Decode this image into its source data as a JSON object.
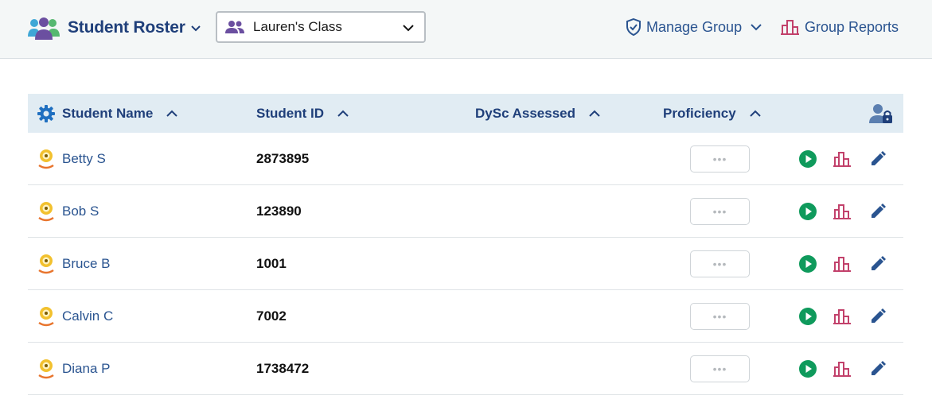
{
  "header": {
    "title": "Student Roster",
    "class_select": {
      "selected": "Lauren's Class"
    },
    "manage_group_label": "Manage Group",
    "group_reports_label": "Group Reports"
  },
  "table": {
    "columns": [
      {
        "key": "name",
        "label": "Student Name"
      },
      {
        "key": "id",
        "label": "Student ID"
      },
      {
        "key": "dysc",
        "label": "DySc Assessed"
      },
      {
        "key": "proficiency",
        "label": "Proficiency"
      }
    ],
    "rows": [
      {
        "name": "Betty S",
        "id": "2873895",
        "proficiency": "•••"
      },
      {
        "name": "Bob S",
        "id": "123890",
        "proficiency": "•••"
      },
      {
        "name": "Bruce B",
        "id": "1001",
        "proficiency": "•••"
      },
      {
        "name": "Calvin C",
        "id": "7002",
        "proficiency": "•••"
      },
      {
        "name": "Diana P",
        "id": "1738472",
        "proficiency": "•••"
      }
    ]
  },
  "colors": {
    "brand": "#1f3f7a",
    "link": "#2a5490",
    "header_bg": "#e1ecf3",
    "play": "#0f9a5c",
    "report": "#c2416b"
  },
  "icons": {
    "brand": "group-people-icon",
    "class": "people-icon",
    "manage": "shield-check-icon",
    "reports": "bar-chart-icon",
    "settings": "gear-icon",
    "lock": "user-lock-icon",
    "avatar": "student-avatar-icon",
    "play": "play-icon",
    "report": "report-icon",
    "edit": "pencil-icon"
  }
}
